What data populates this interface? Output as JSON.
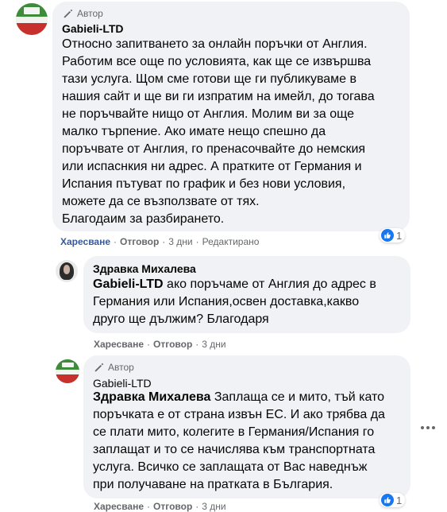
{
  "comment1": {
    "badge": "Автор",
    "author": "Gabieli-LTD",
    "text": "Относно запитването за онлайн поръчки от Англия.\nРаботим все още по условията, как ще се извършва\nтази услуга. Щом сме готови ще ги публикуваме в\nнашия сайт и ще ви ги изпратим на имейл, до тогава\nне поръчвайте нищо от Англия. Молим ви за още\nмалко търпение. Ако имате нещо спешно да\nпоръчвате от Англия, го пренасочвайте до немския\nили испаснкия ни адрес. А пратките от Германия и\nИспания пътуват по график и без нови условия,\nможете да се възползвате от тях.\nБлагодаим за разбирането.",
    "like": "Харесване",
    "reply": "Отговор",
    "time": "3 дни",
    "edited": "Редактирано",
    "reaction_count": "1"
  },
  "reply1": {
    "author": "Здравка Михалева",
    "mention": "Gabieli-LTD",
    "text": " ако поръчаме от Англия до адрес в\nГермания или Испания,освен доставка,какво\nдруго ще дължим? Благодаря",
    "like": "Харесване",
    "reply": "Отговор",
    "time": "3 дни"
  },
  "reply2": {
    "badge": "Автор",
    "author": "Gabieli-LTD",
    "mention": "Здравка Михалева",
    "text": " Заплаща се и мито, тъй като\nпоръчката е от страна извън ЕС. И ако трябва да\nсе плати мито, колегите в Германия/Испания го\nзаплащат и то се начислява към транспортната\nуслуга. Всичко се заплащата от Вас наведнъж\nпри получаване на пратката в България.",
    "like": "Харесване",
    "reply": "Отговор",
    "time": "3 дни",
    "reaction_count": "1"
  },
  "dot": "·",
  "icons": {
    "badge": "pencil-icon",
    "reaction": "thumbs-up-icon",
    "more": "more-options-icon"
  },
  "colors": {
    "bubble": "#f0f2f5",
    "like_blue": "#1877f2",
    "secondary_text": "#65676b"
  }
}
